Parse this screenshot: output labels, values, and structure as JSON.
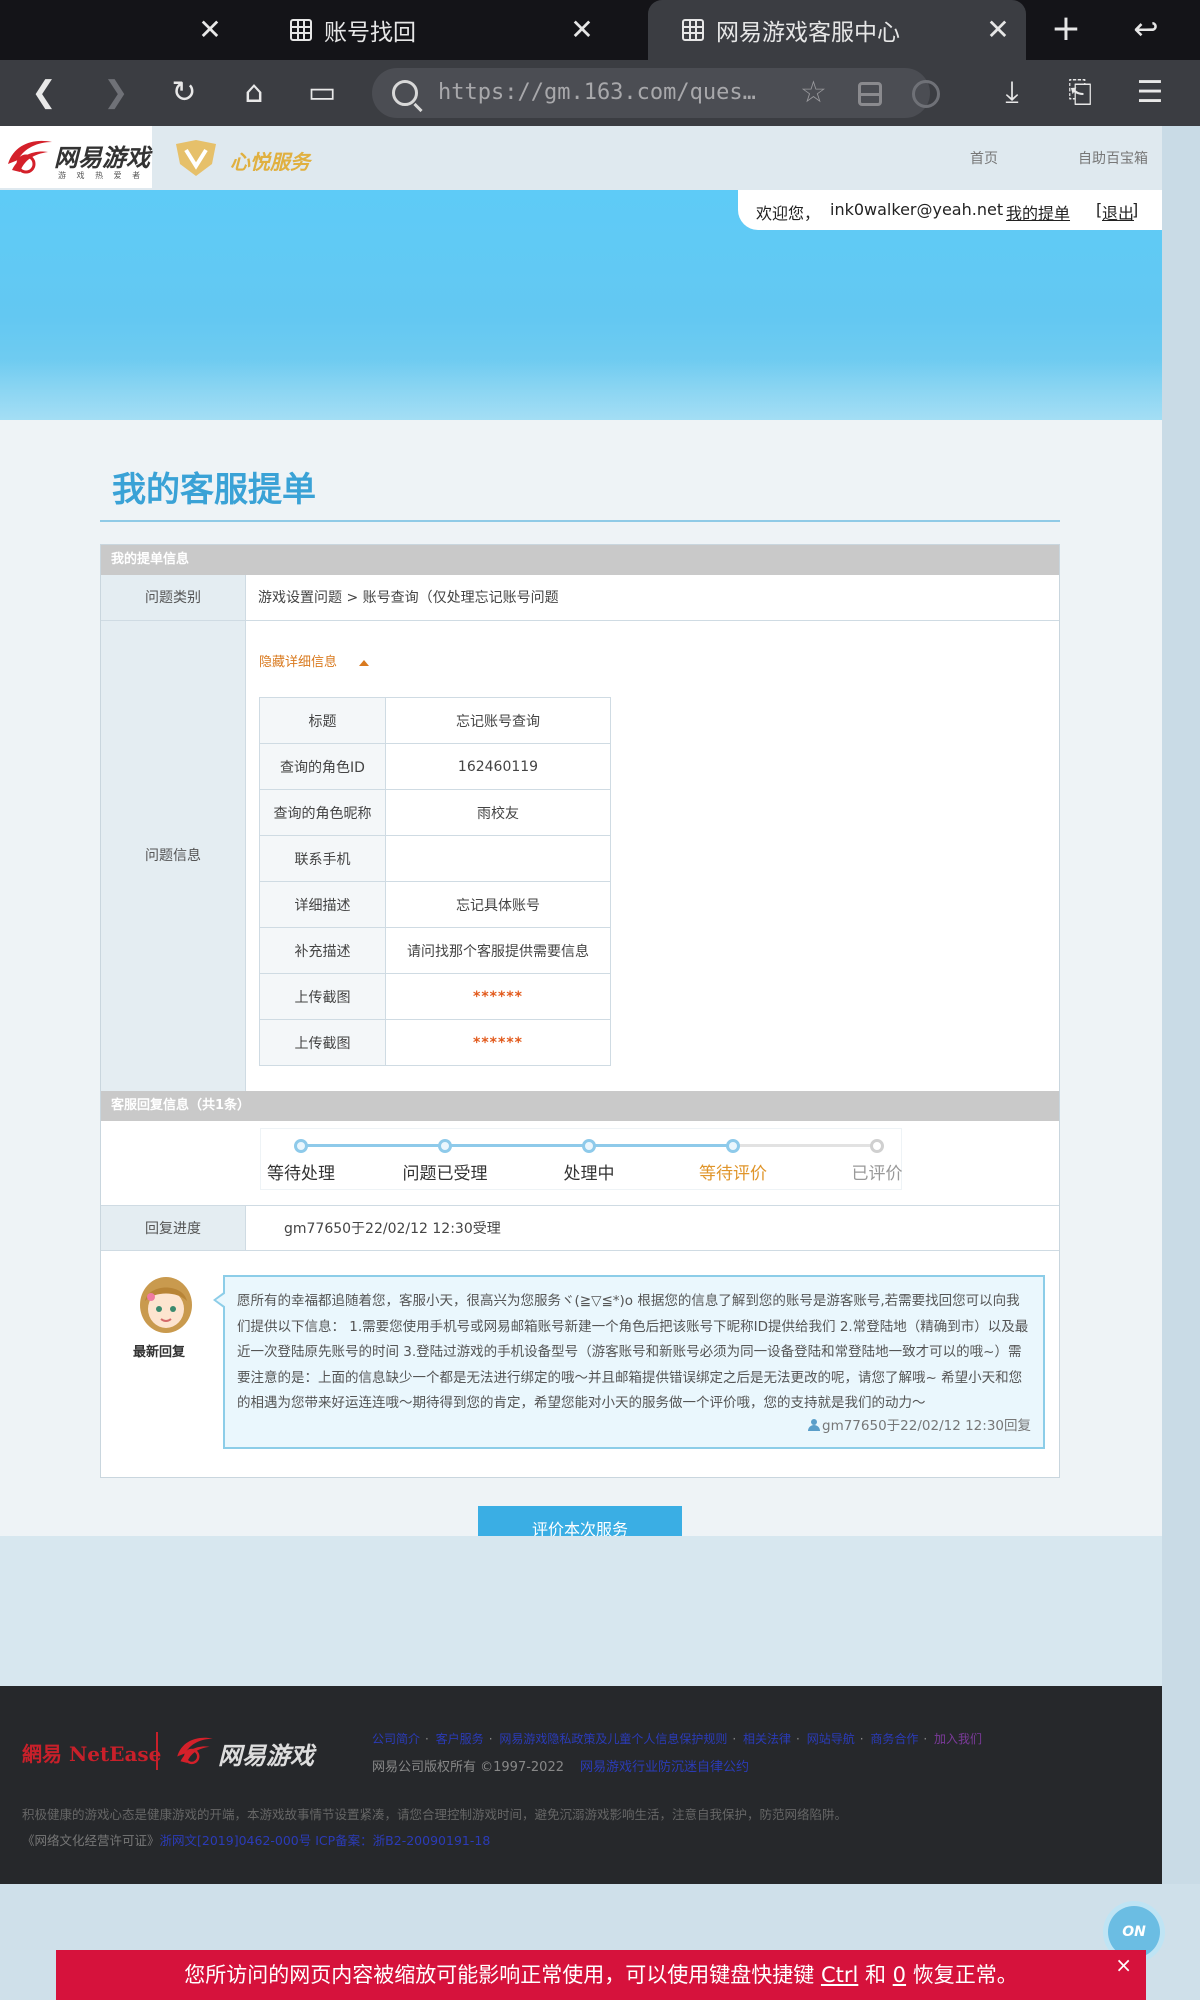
{
  "browser": {
    "tab_close_icon": "close-icon",
    "tabs": [
      {
        "title": "账号找回",
        "active": false
      },
      {
        "title": "网易游戏客服中心",
        "active": true
      }
    ],
    "url": "https://gm.163.com/questi…"
  },
  "header": {
    "logo_text": "网易游戏",
    "logo_sub": "游 戏 热 爱 者",
    "service_logo_text": "心悦服务",
    "links": {
      "home": "首页",
      "selfhelp": "自助百宝箱"
    }
  },
  "welcome": {
    "greeting": "欢迎您，",
    "email": "ink0walker@yeah.net",
    "my_tickets": "我的提单",
    "logout_open": "[",
    "logout": "退出",
    "logout_close": "]"
  },
  "main": {
    "title": "我的客服提单",
    "ticket_section": "我的提单信息",
    "category_label": "问题类别",
    "category_value": "游戏设置问题 > 账号查询（仅处理忘记账号问题",
    "info_label": "问题信息",
    "toggle_label": "隐藏详细信息",
    "details": [
      {
        "key": "标题",
        "value": "忘记账号查询",
        "masked": false
      },
      {
        "key": "查询的角色ID",
        "value": "162460119",
        "masked": false
      },
      {
        "key": "查询的角色昵称",
        "value": "雨校友",
        "masked": false
      },
      {
        "key": "联系手机",
        "value": "",
        "masked": false
      },
      {
        "key": "详细描述",
        "value": "忘记具体账号",
        "masked": false
      },
      {
        "key": "补充描述",
        "value": "请问找那个客服提供需要信息",
        "masked": false
      },
      {
        "key": "上传截图",
        "value": "******",
        "masked": true
      },
      {
        "key": "上传截图",
        "value": "******",
        "masked": true
      }
    ],
    "reply_section": "客服回复信息（共1条）",
    "steps": [
      {
        "label": "等待处理",
        "state": "done"
      },
      {
        "label": "问题已受理",
        "state": "done"
      },
      {
        "label": "处理中",
        "state": "done"
      },
      {
        "label": "等待评价",
        "state": "current"
      },
      {
        "label": "已评价",
        "state": "todo"
      }
    ],
    "progress_label": "回复进度",
    "progress_value": "gm77650于22/02/12 12:30受理",
    "avatar_label": "最新回复",
    "reply_text": "愿所有的幸福都追随着您，客服小天，很高兴为您服务ヾ(≧▽≦*)o 根据您的信息了解到您的账号是游客账号,若需要找回您可以向我们提供以下信息： 1.需要您使用手机号或网易邮箱账号新建一个角色后把该账号下昵称ID提供给我们 2.常登陆地（精确到市）以及最近一次登陆原先账号的时间 3.登陆过游戏的手机设备型号（游客账号和新账号必须为同一设备登陆和常登陆地一致才可以的哦~）需要注意的是：上面的信息缺少一个都是无法进行绑定的哦～并且邮箱提供错误绑定之后是无法更改的呢，请您了解哦~ 希望小天和您的相遇为您带来好运连连哦～期待得到您的肯定，希望您能对小天的服务做一个评价哦，您的支持就是我们的动力～",
    "reply_meta": "gm77650于22/02/12 12:30回复",
    "eval_button": "评价本次服务"
  },
  "footer": {
    "netease": "網易 NetEase",
    "logo_text": "网易游戏",
    "links": [
      "公司简介",
      "客户服务",
      "网易游戏隐私政策及儿童个人信息保护规则",
      "相关法律",
      "网站导航",
      "商务合作",
      "加入我们"
    ],
    "copyright": "网易公司版权所有 ©1997-2022",
    "copyright_link": "网易游戏行业防沉迷自律公约",
    "note": "积极健康的游戏心态是健康游戏的开端，本游戏故事情节设置紧凑，请您合理控制游戏时间，避免沉溺游戏影响生活，注意自我保护，防范网络陷阱。",
    "license_prefix": "《网络文化经营许可证》",
    "license_link": "浙网文[2019]0462-000号 ICP备案：浙B2-20090191-18"
  },
  "float_button": "ON",
  "zoom_bar": {
    "text_before": "您所访问的网页内容被缩放可能影响正常使用，可以使用键盘快捷键 ",
    "key1": "Ctrl",
    "middle": " 和 ",
    "key2": "0",
    "text_after": " 恢复正常。",
    "close": "×"
  },
  "colors": {
    "accent": "#3aaee4",
    "title": "#3aa2d6",
    "warning_bar": "#d6123c",
    "step_current": "#e0952a"
  }
}
